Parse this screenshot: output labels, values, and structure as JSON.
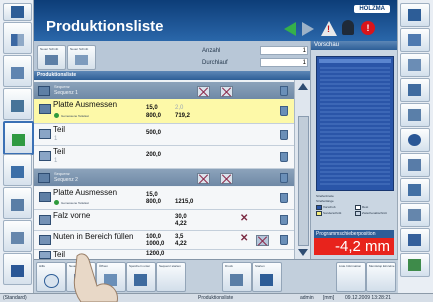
{
  "title": "Produktionsliste",
  "brand": "HOLZMA",
  "header": {
    "btn1": "Neuer Schnitt",
    "btn2": "Neuer Schnitt",
    "anzahl_label": "Anzahl",
    "anzahl_value": "1",
    "durchlauf_label": "Durchlauf",
    "durchlauf_value": "1"
  },
  "list_header": "Produktionsliste",
  "sequences": [
    {
      "label": "Sequenz 1",
      "caption": "Sequenz"
    },
    {
      "label": "Sequenz 2",
      "caption": "Sequenz"
    }
  ],
  "rows": [
    {
      "name": "Platte Ausmessen",
      "a": "15,0",
      "b": "800,0",
      "c": "2,0",
      "d": "719,2",
      "status": "Gemessene Teilelast"
    },
    {
      "name": "Teil",
      "a": "500,0",
      "b": "1"
    },
    {
      "name": "Teil",
      "a": "200,0",
      "b": "1"
    },
    {
      "name": "Platte Ausmessen",
      "a": "15,0",
      "b": "800,0",
      "c": "1215,0",
      "status": "Gemessene Teilelast"
    },
    {
      "name": "Falz vorne",
      "a": "30,0",
      "b": "4,22"
    },
    {
      "name": "Nuten in Bereich füllen",
      "a": "100,0",
      "b": "1000,0",
      "c": "3,5",
      "d": "4,22"
    },
    {
      "name": "Teil",
      "a": "1200,0"
    }
  ],
  "preview": {
    "title": "Vorschau",
    "legend": [
      "Streifenbreite",
      "Streifenlänge",
      "Vorschub",
      "Rest",
      "Sonderschnitt",
      "Zwischenabschnitt"
    ],
    "readout_title": "Programmschieberposition",
    "readout": "-4,2 mm"
  },
  "bottom": {
    "btn1": "Hilfe",
    "btn2": "Neue Liste",
    "btn3": "Öffnen",
    "btn4": "Speichern unter",
    "btn5": "Sequenz starten",
    "btn6": "Druck",
    "btn7": "Starten",
    "btn8": "Liste Information",
    "btn9": "Menüstop Einzelne"
  },
  "status": {
    "left": "(Standard)",
    "mid": "Produktionsliste",
    "user": "admin",
    "unit": "[mm]",
    "date": "09.12.2009 13:28:21"
  },
  "colors": {
    "header": "#1e5598",
    "accent_green": "#35b04a",
    "readout": "#e8231c"
  }
}
